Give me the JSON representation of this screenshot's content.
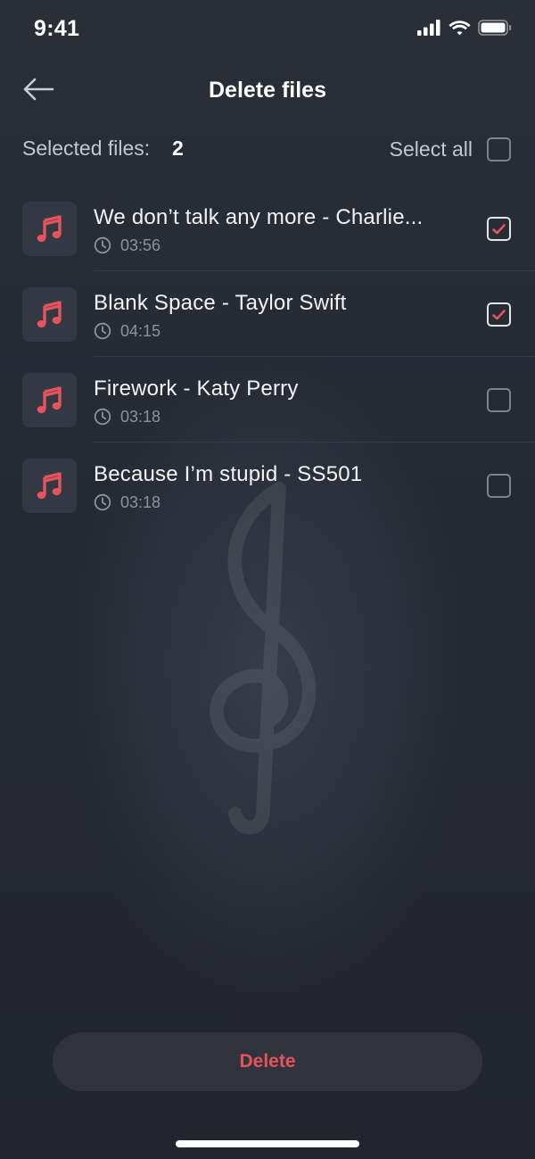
{
  "status_bar": {
    "time": "9:41"
  },
  "header": {
    "title": "Delete files",
    "back_icon": "arrow-left-icon"
  },
  "selection": {
    "label": "Selected files:",
    "count": "2",
    "select_all_label": "Select all",
    "select_all_checked": false
  },
  "files": [
    {
      "title": "We don’t talk any more - Charlie...",
      "duration": "03:56",
      "checked": true
    },
    {
      "title": "Blank Space - Taylor Swift",
      "duration": "04:15",
      "checked": true
    },
    {
      "title": "Firework - Katy Perry",
      "duration": "03:18",
      "checked": false
    },
    {
      "title": "Because I’m stupid - SS501",
      "duration": "03:18",
      "checked": false
    }
  ],
  "actions": {
    "delete_label": "Delete"
  },
  "colors": {
    "background": "#23262f",
    "accent": "#e5545c",
    "thumb_bg": "#343842",
    "button_bg": "#30333b"
  }
}
